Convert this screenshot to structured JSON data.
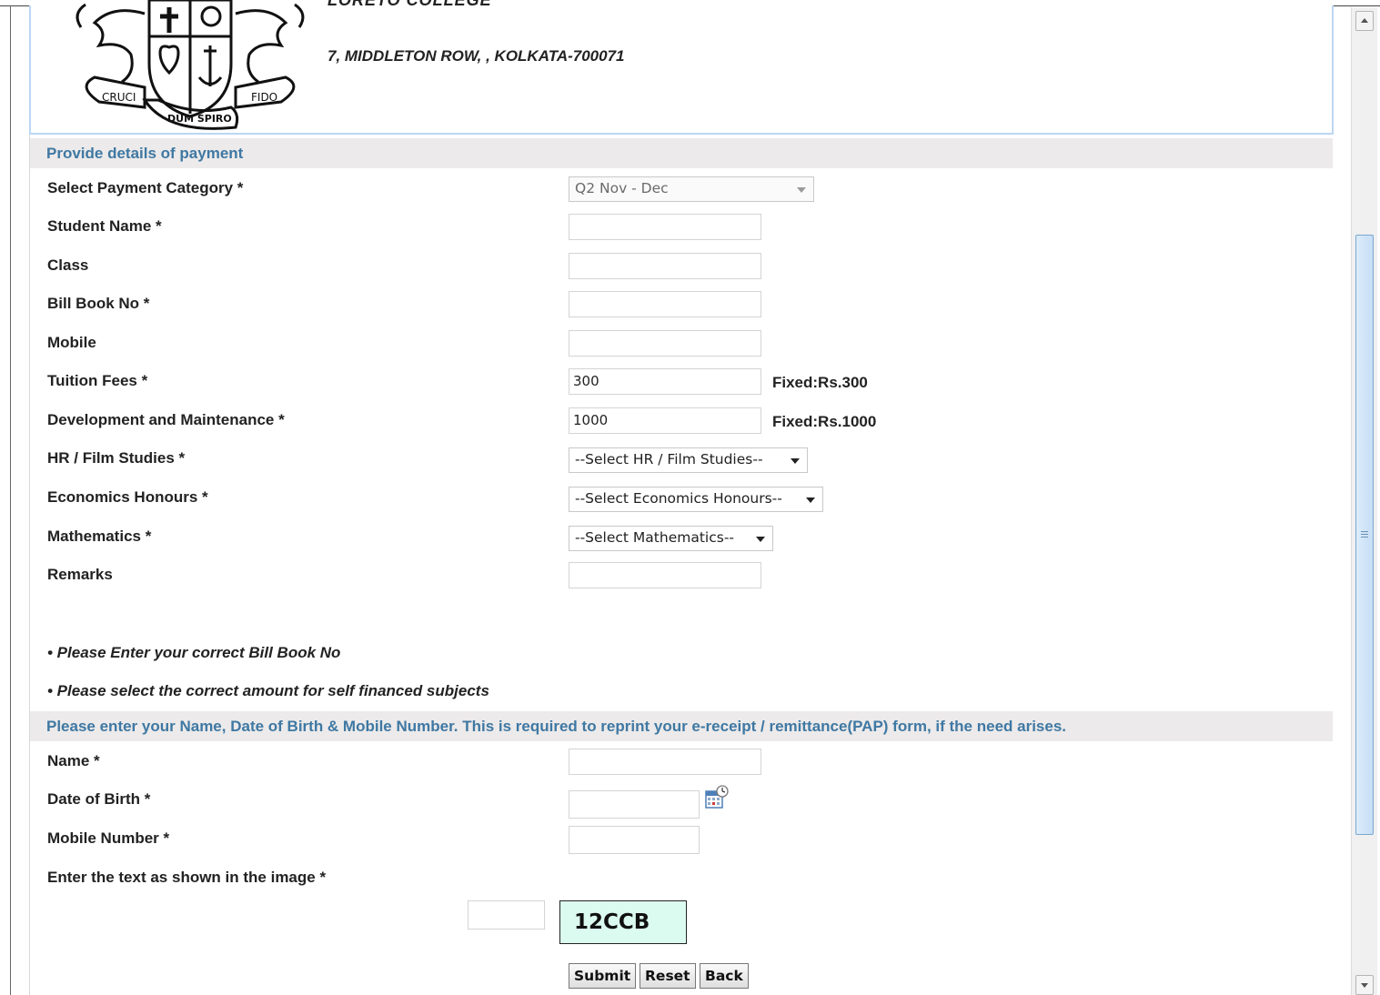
{
  "header": {
    "college_name": "LORETO COLLEGE",
    "address": "7, MIDDLETON ROW, , KOLKATA-700071",
    "logo_text": [
      "CRUCI",
      "DUM SPIRO",
      "FIDO"
    ]
  },
  "payment_section": {
    "title": "Provide details of payment",
    "fields": {
      "category": {
        "label": "Select Payment Category *",
        "value": "Q2 Nov - Dec"
      },
      "student_name": {
        "label": "Student Name *",
        "value": ""
      },
      "class": {
        "label": "Class",
        "value": ""
      },
      "bill_book_no": {
        "label": "Bill Book No *",
        "value": ""
      },
      "mobile": {
        "label": "Mobile",
        "value": ""
      },
      "tuition_fees": {
        "label": "Tuition Fees *",
        "value": "300",
        "note": "Fixed:Rs.300"
      },
      "development": {
        "label": "Development and Maintenance *",
        "value": "1000",
        "note": "Fixed:Rs.1000"
      },
      "hr_film": {
        "label": "HR / Film Studies *",
        "value": "--Select HR / Film Studies--"
      },
      "economics": {
        "label": "Economics Honours *",
        "value": "--Select Economics Honours--"
      },
      "mathematics": {
        "label": "Mathematics *",
        "value": "--Select Mathematics--"
      },
      "remarks": {
        "label": "Remarks",
        "value": ""
      }
    },
    "notes": [
      "• Please Enter your correct Bill Book No",
      "• Please select the correct amount for self financed subjects"
    ]
  },
  "reprint_section": {
    "title": "Please enter your Name, Date of Birth & Mobile Number. This is required to reprint your e-receipt / remittance(PAP) form, if the need arises.",
    "fields": {
      "name": {
        "label": "Name *",
        "value": ""
      },
      "dob": {
        "label": "Date of Birth *",
        "value": ""
      },
      "mobile_number": {
        "label": "Mobile Number *",
        "value": ""
      },
      "captcha": {
        "label": "Enter the text as shown in the image *",
        "value": "",
        "image_text": "12CCB"
      }
    }
  },
  "buttons": {
    "submit": "Submit",
    "reset": "Reset",
    "back": "Back"
  },
  "colors": {
    "section_title": "#3f78a3",
    "section_bg": "#eceaea",
    "captcha_bg": "#dcfbf0",
    "header_border": "#bcd6f2"
  }
}
